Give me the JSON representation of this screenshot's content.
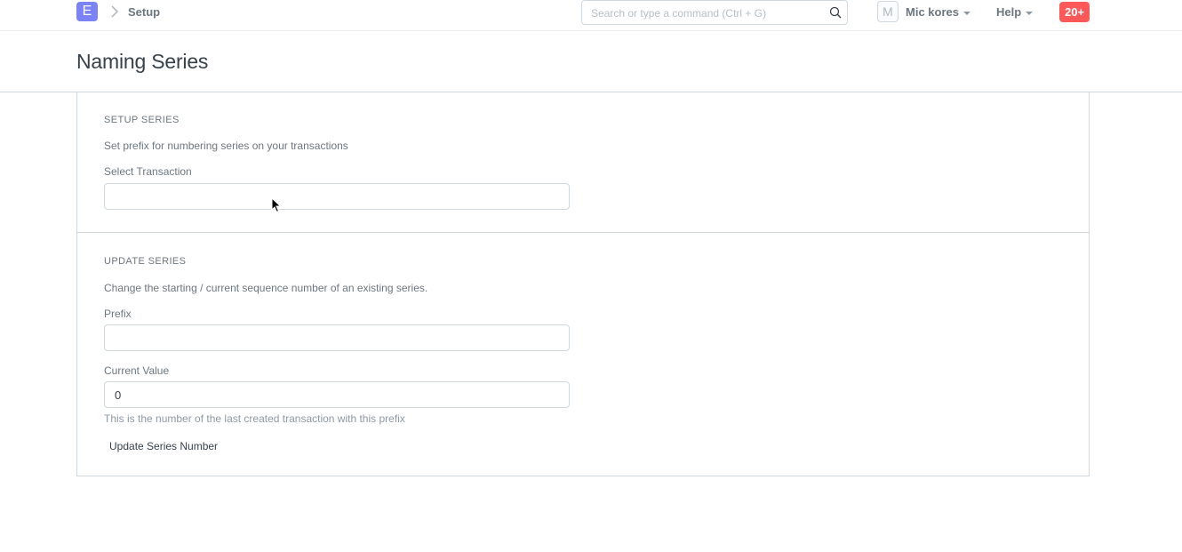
{
  "navbar": {
    "logo_letter": "E",
    "breadcrumb": "Setup",
    "search_placeholder": "Search or type a command (Ctrl + G)",
    "avatar_initial": "M",
    "user_name": "Mic kores",
    "help_label": "Help",
    "notifications": "20+"
  },
  "page": {
    "title": "Naming Series"
  },
  "setup_section": {
    "heading": "SETUP SERIES",
    "description": "Set prefix for numbering series on your transactions",
    "select_label": "Select Transaction",
    "select_value": ""
  },
  "update_section": {
    "heading": "UPDATE SERIES",
    "description": "Change the starting / current sequence number of an existing series.",
    "prefix_label": "Prefix",
    "prefix_value": "",
    "current_value_label": "Current Value",
    "current_value": "0",
    "current_value_help": "This is the number of the last created transaction with this prefix",
    "button_label": "Update Series Number"
  },
  "colors": {
    "logo": "#7b83f7",
    "badge": "#ff5858",
    "border": "#d1d8dd",
    "text": "#36414c",
    "muted": "#6c7680"
  },
  "icons": [
    "chevron-right-icon",
    "search-icon",
    "caret-down-icon",
    "mouse-cursor-icon"
  ]
}
